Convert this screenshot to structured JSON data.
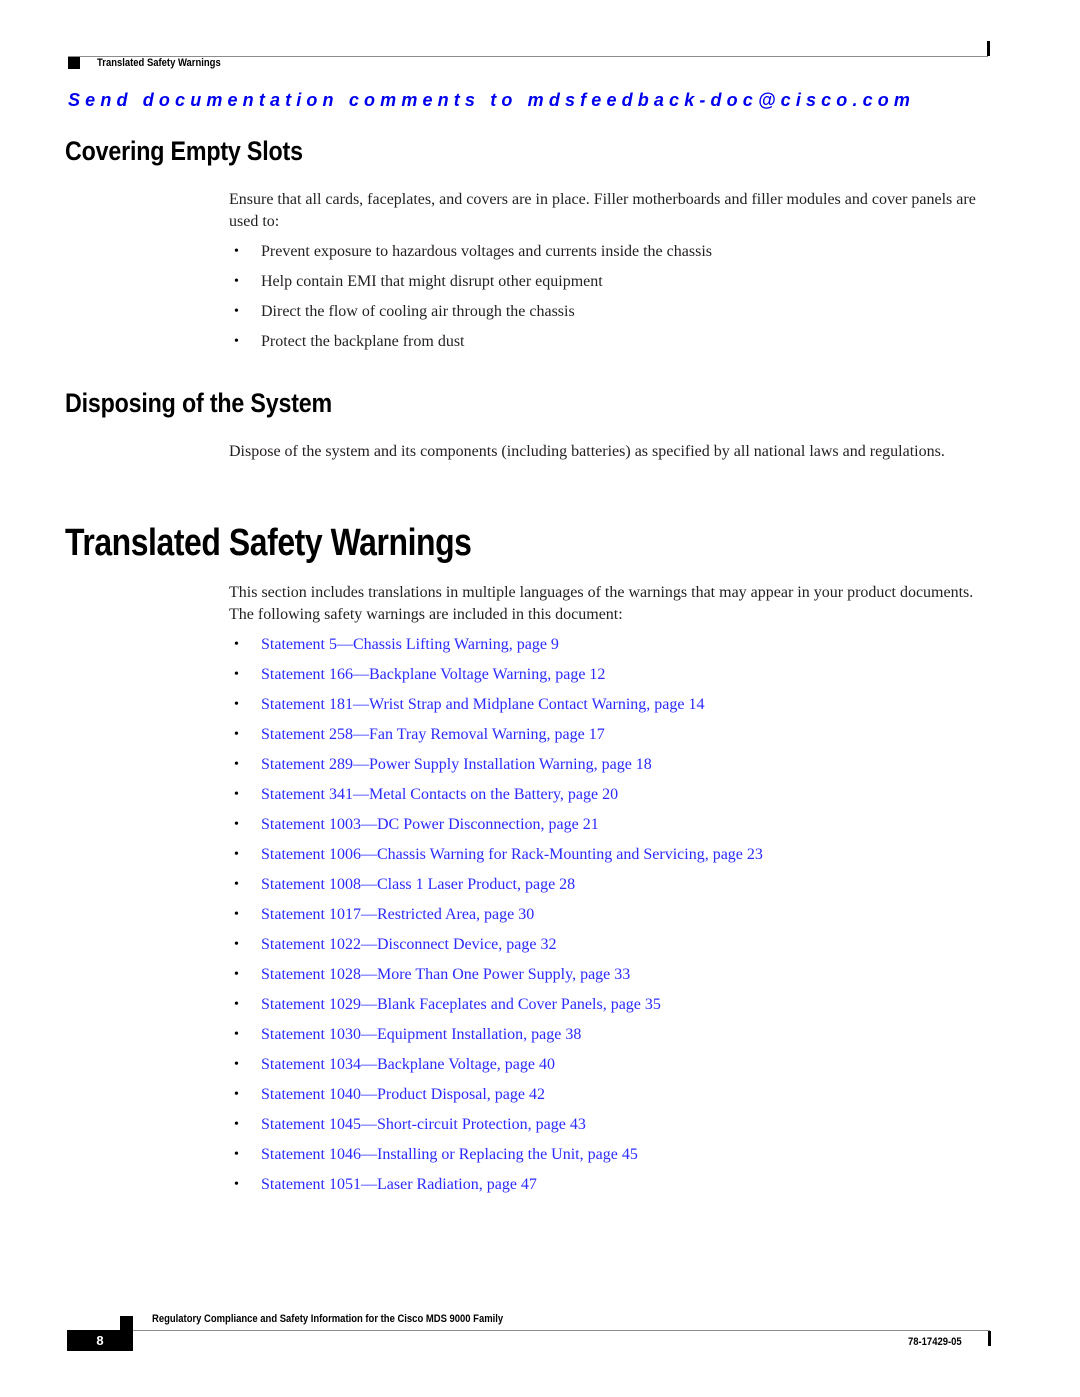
{
  "header": {
    "running_title": "Translated Safety Warnings",
    "feedback_line": "Send documentation comments to mdsfeedback-doc@cisco.com"
  },
  "sections": {
    "covering": {
      "heading": "Covering Empty Slots",
      "intro": "Ensure that all cards, faceplates, and covers are in place. Filler motherboards and filler modules and cover panels are used to:",
      "bullets": [
        "Prevent exposure to hazardous voltages and currents inside the chassis",
        "Help contain EMI that might disrupt other equipment",
        "Direct the flow of cooling air through the chassis",
        "Protect the backplane from dust"
      ]
    },
    "disposing": {
      "heading": "Disposing of the System",
      "body": "Dispose of the system and its components (including batteries) as specified by all national laws and regulations."
    },
    "translated": {
      "heading": "Translated Safety Warnings",
      "intro": "This section includes translations in multiple languages of the warnings that may appear in your product documents. The following safety warnings are included in this document:",
      "links": [
        "Statement 5—Chassis Lifting Warning, page 9",
        "Statement 166—Backplane Voltage Warning, page 12",
        "Statement 181—Wrist Strap and Midplane Contact Warning, page 14",
        "Statement 258—Fan Tray Removal Warning, page 17",
        "Statement 289—Power Supply Installation Warning, page 18",
        "Statement 341—Metal Contacts on the Battery, page 20",
        "Statement 1003—DC Power Disconnection, page 21",
        "Statement 1006—Chassis Warning for Rack-Mounting and Servicing, page 23",
        "Statement 1008—Class 1 Laser Product, page 28",
        "Statement 1017—Restricted Area, page 30",
        "Statement 1022—Disconnect Device, page 32",
        "Statement 1028—More Than One Power Supply, page 33",
        "Statement 1029—Blank Faceplates and Cover Panels, page 35",
        "Statement 1030—Equipment Installation, page 38",
        "Statement 1034—Backplane Voltage, page 40",
        "Statement 1040—Product Disposal, page 42",
        "Statement 1045—Short-circuit Protection, page 43",
        "Statement 1046—Installing or Replacing the Unit, page 45",
        "Statement 1051—Laser Radiation, page 47"
      ]
    }
  },
  "footer": {
    "book_title": "Regulatory Compliance and Safety Information for the Cisco MDS 9000 Family",
    "page_number": "8",
    "doc_number": "78-17429-05"
  },
  "colors": {
    "link": "#2b2bff",
    "feedback": "#0000ee",
    "rule": "#8c8c8c"
  }
}
